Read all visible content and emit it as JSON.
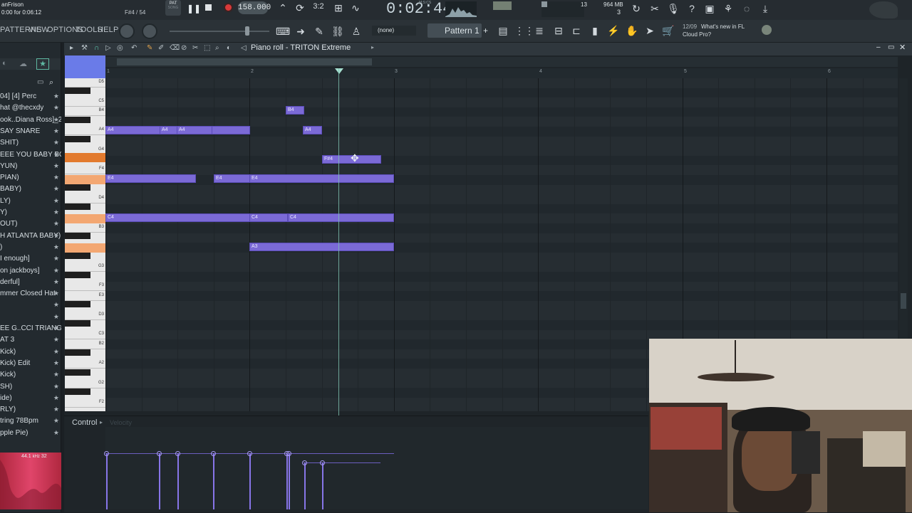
{
  "topbar": {
    "user": "anFrison",
    "time_info": "0:00 for 0:06:12",
    "note_info": "F#4 / 54",
    "song_mode": "PAT",
    "song_label": "SONG",
    "tempo": "158.000",
    "clock": "0:02:44",
    "clock_unit": "M:S:CS",
    "cpu_count": "13",
    "memory": "964 MB",
    "memory_sub": "3",
    "news_date": "12/09",
    "news_text": "What's new in FL",
    "news_text2": "Cloud Pro?"
  },
  "menu": [
    "PATTERNS",
    "VIEW",
    "OPTIONS",
    "TOOLS",
    "HELP"
  ],
  "toolbar": {
    "none_label": "(none)",
    "pattern_label": "Pattern 1",
    "pattern_add": "+"
  },
  "browser": {
    "items": [
      "04] [4] Perc",
      "hat @thecxdy",
      "ook..Diana Ross]_2",
      "SAY SNARE",
      "SHIT)",
      "EEE YOU BABY BOI)",
      "YUN)",
      "PIAN)",
      "BABY)",
      "LY)",
      "Y)",
      "OUT)",
      "H ATLANTA BABY)",
      ")",
      "I enough]",
      "on jackboys]",
      "derful]",
      "mmer Closed Hat",
      "",
      "",
      "EE G..CCI TRIANGLE",
      "AT 3",
      "Kick)",
      "Kick) Edit",
      "Kick)",
      "SH)",
      "ide)",
      "RLY)",
      "tring 78Bpm",
      "pple Pie)"
    ],
    "sample_rate": "44.1",
    "sample_unit": "kHz",
    "bits": "32"
  },
  "piano_roll": {
    "title": "Piano roll - TRITON Extreme",
    "bars": [
      "1",
      "2",
      "3",
      "4",
      "5",
      "6"
    ],
    "key_labels": [
      "D5",
      "C5",
      "B4",
      "A4",
      "G4",
      "F4",
      "E4",
      "D4",
      "C4",
      "B3",
      "A3",
      "G3",
      "F3",
      "E3",
      "D3",
      "C3",
      "B2",
      "A2",
      "G2",
      "F2"
    ],
    "notes": [
      {
        "label": "B4"
      },
      {
        "label": "A4"
      },
      {
        "label": "A4"
      },
      {
        "label": "A4"
      },
      {
        "label": "A4"
      },
      {
        "label": "F#4"
      },
      {
        "label": "E4"
      },
      {
        "label": "E4"
      },
      {
        "label": "E4"
      },
      {
        "label": "C4"
      },
      {
        "label": "C4"
      },
      {
        "label": "C4"
      },
      {
        "label": "A3"
      }
    ],
    "control_label": "Control",
    "control_param": "Velocity"
  },
  "colors": {
    "note": "#7b6ad6",
    "accent_key": "#e27a2e",
    "playhead": "#7fc3b2",
    "background": "#1b2024"
  }
}
